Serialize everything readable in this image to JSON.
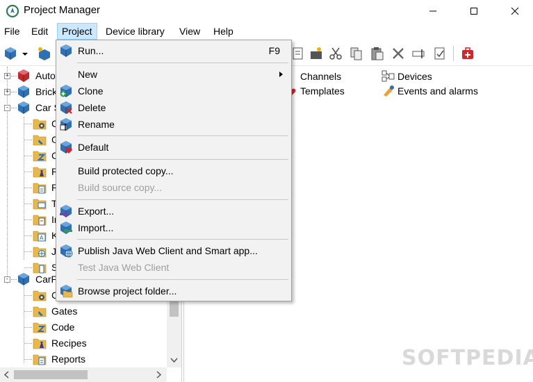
{
  "window": {
    "title": "Project Manager",
    "buttons": [
      "minimize",
      "maximize",
      "close"
    ]
  },
  "menubar": {
    "items": [
      "File",
      "Edit",
      "Project",
      "Device library",
      "View",
      "Help"
    ],
    "active": "Project"
  },
  "project_menu": {
    "items": [
      {
        "label": "Run...",
        "shortcut": "F9",
        "icon": "run-icon",
        "enabled": true
      },
      {
        "label": "New",
        "icon": "",
        "enabled": true,
        "submenu": true
      },
      {
        "label": "Clone",
        "icon": "clone-icon",
        "enabled": true
      },
      {
        "label": "Delete",
        "icon": "delete-icon",
        "enabled": true
      },
      {
        "label": "Rename",
        "icon": "rename-icon",
        "enabled": true
      },
      {
        "label": "Default",
        "icon": "default-heart-icon",
        "enabled": true
      },
      {
        "label": "Build protected copy...",
        "icon": "",
        "enabled": true
      },
      {
        "label": "Build source copy...",
        "icon": "",
        "enabled": false
      },
      {
        "label": "Export...",
        "icon": "export-icon",
        "enabled": true
      },
      {
        "label": "Import...",
        "icon": "import-icon",
        "enabled": true
      },
      {
        "label": "Publish Java Web Client and Smart app...",
        "icon": "publish-web-icon",
        "enabled": true
      },
      {
        "label": "Test Java Web Client",
        "icon": "",
        "enabled": false
      },
      {
        "label": "Browse project folder...",
        "icon": "folder-icon",
        "enabled": true
      }
    ]
  },
  "tree": {
    "nodes": [
      {
        "label": "Auto",
        "expander": "+",
        "icon": "project-red-cube-icon"
      },
      {
        "label": "Brick",
        "expander": "+",
        "icon": "project-cube-icon"
      },
      {
        "label": "Car S",
        "expander": "-",
        "icon": "project-cube-icon"
      },
      {
        "label": "C",
        "icon": "gear-folder-icon"
      },
      {
        "label": "G",
        "icon": "gates-folder-icon"
      },
      {
        "label": "C",
        "icon": "code-folder-icon"
      },
      {
        "label": "R",
        "icon": "recipes-folder-icon"
      },
      {
        "label": "R",
        "icon": "reports-folder-icon"
      },
      {
        "label": "T",
        "icon": "terminal-folder-icon"
      },
      {
        "label": "In",
        "icon": "info-folder-icon"
      },
      {
        "label": "K",
        "icon": "keys-folder-icon"
      },
      {
        "label": "J",
        "icon": "web-folder-icon"
      },
      {
        "label": "S",
        "icon": "smart-folder-icon"
      },
      {
        "label": "CarP",
        "expander": "-",
        "icon": "project-cube-icon"
      },
      {
        "label": "C",
        "icon": "gear-folder-icon"
      },
      {
        "label": "Gates",
        "icon": "gates-folder-icon"
      },
      {
        "label": "Code",
        "icon": "code-folder-icon"
      },
      {
        "label": "Recipes",
        "icon": "recipes-folder-icon"
      },
      {
        "label": "Reports",
        "icon": "reports-folder-icon"
      }
    ]
  },
  "right_pane": {
    "items": [
      {
        "label": "Channels",
        "icon": "channels-icon"
      },
      {
        "label": "Devices",
        "icon": "devices-icon"
      },
      {
        "label": "Templates",
        "icon": "templates-icon"
      },
      {
        "label": "Events and alarms",
        "icon": "events-alarms-icon"
      }
    ]
  },
  "watermark": "SOFTPEDIA",
  "colors": {
    "menu_active_bg": "#cce8ff",
    "menu_active_border": "#99d1ff",
    "dropdown_bg": "#f2f2f2",
    "disabled_text": "#9e9e9e",
    "cube_blue": "#2f6fb4",
    "cube_red": "#c0282d",
    "folder_yellow": "#e8b84a"
  }
}
